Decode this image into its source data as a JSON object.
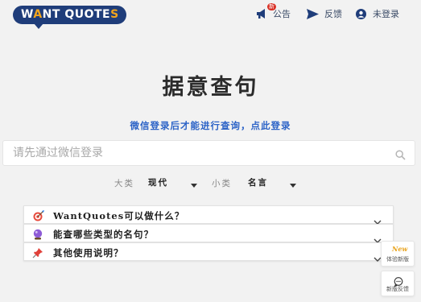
{
  "header": {
    "logo": {
      "prefix": "W",
      "mark": "A",
      "rest": "NT QUOTE",
      "mark2": "S",
      "brand_color": "#1f3d7a",
      "accent_color": "#f2a51c"
    },
    "nav": {
      "announce_badge": "新",
      "announce_label": "公告",
      "feedback_label": "反馈",
      "login_label": "未登录"
    }
  },
  "main": {
    "title": "据意查句",
    "login_prompt": "微信登录后才能进行查询，点此登录",
    "search": {
      "placeholder": "请先通过微信登录",
      "value": ""
    },
    "filters": {
      "category_label": "大类",
      "category_value": "现代",
      "subcategory_label": "小类",
      "subcategory_value": "名言"
    },
    "faq": [
      {
        "icon": "target-dart-icon",
        "question": "WantQuotes可以做什么？"
      },
      {
        "icon": "crystal-ball-icon",
        "question": "能查哪些类型的名句？"
      },
      {
        "icon": "pushpin-icon",
        "question": "其他使用说明？"
      }
    ]
  },
  "floating": {
    "try_new_badge": "New",
    "try_new_label": "体验新版",
    "feedback_label": "新版反馈"
  },
  "colors": {
    "link": "#2c63c7",
    "background": "#f2f2f2",
    "nav_text": "#3a4a66"
  }
}
